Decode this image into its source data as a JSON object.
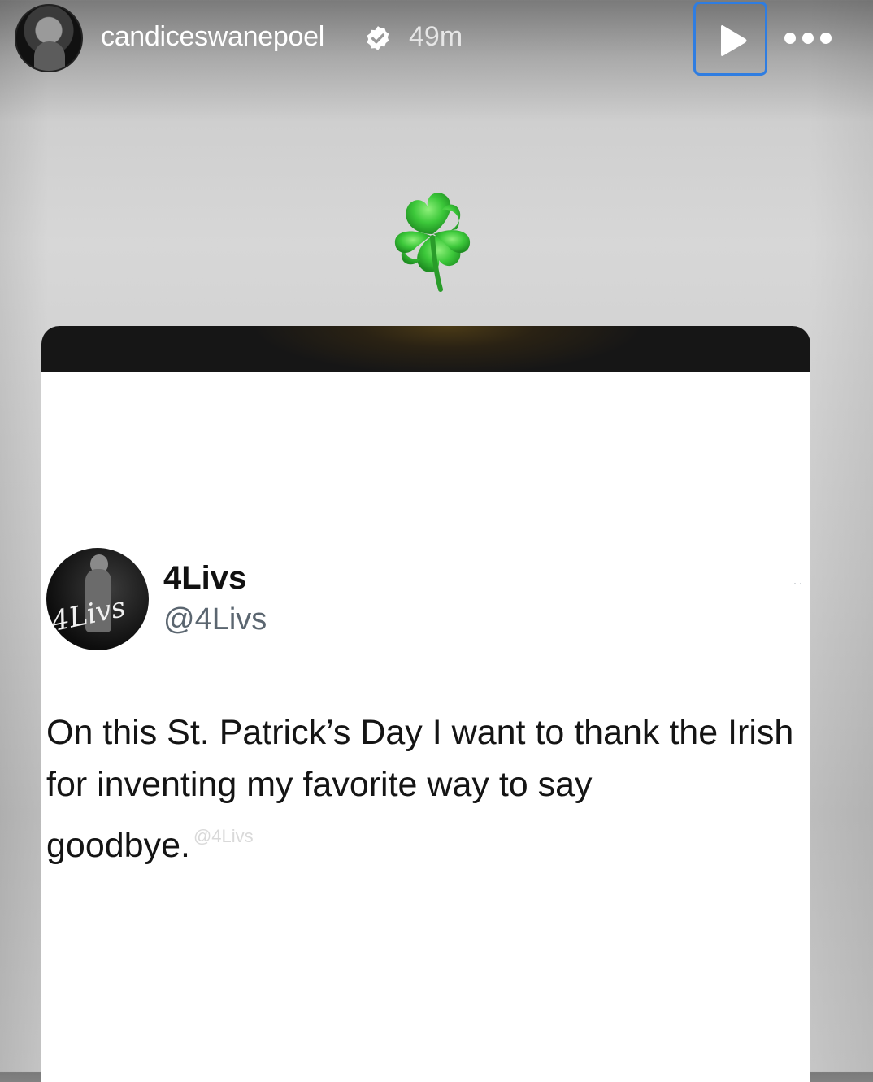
{
  "story": {
    "username": "candiceswanepoel",
    "time_ago": "49m"
  },
  "tweet": {
    "display_name": "4Livs",
    "handle": "@4Livs",
    "avatar_signature": "4Livs",
    "more_glyph": "··",
    "text": "On this St. Patrick’s Day I want to thank the Irish for inventing my favorite way to say goodbye.",
    "watermark": "@4Livs"
  },
  "icons": {
    "verified": "verified-badge-icon",
    "play": "play-icon",
    "more": "more-options-icon",
    "clover": "four-leaf-clover-icon"
  },
  "colors": {
    "accent_focus": "#2f7de1",
    "clover_green": "#38c43a",
    "card_bar": "#161616"
  }
}
